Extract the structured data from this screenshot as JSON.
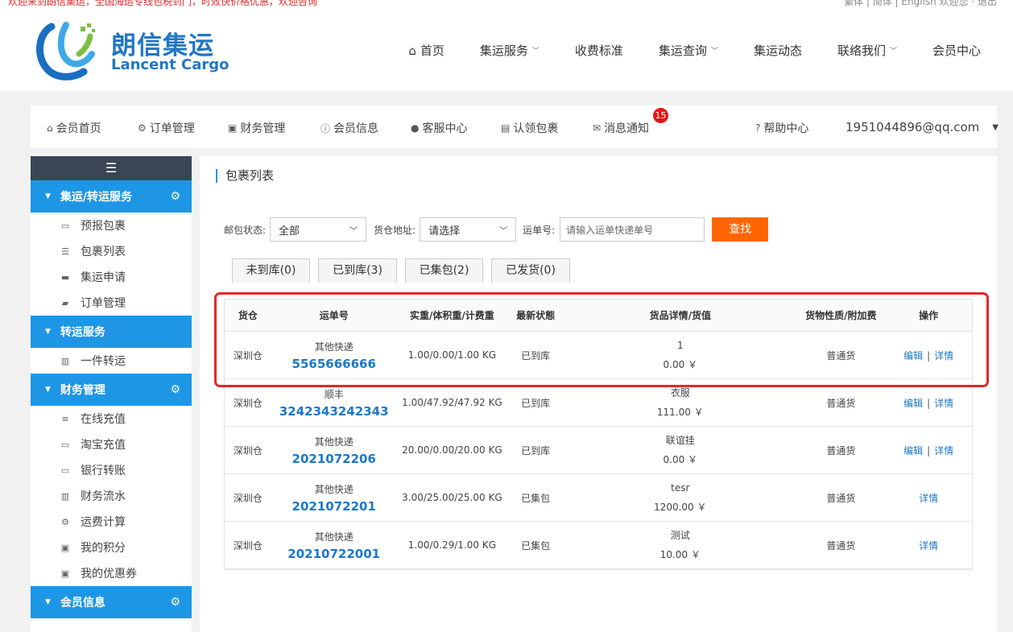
{
  "top_strip": {
    "left_text": "欢迎来到朗信集运，全国海运专线包税到门，时效快价格优惠，欢迎咨询",
    "right_text": "繁体 | 简体 | English 欢迎您 · 退出"
  },
  "logo": {
    "cn": "朗信集运",
    "en": "Lancent Cargo"
  },
  "main_nav": [
    {
      "label": "首页",
      "icon": "home-icon"
    },
    {
      "label": "集运服务",
      "dropdown": true
    },
    {
      "label": "收费标准"
    },
    {
      "label": "集运查询",
      "dropdown": true
    },
    {
      "label": "集运动态"
    },
    {
      "label": "联络我们",
      "dropdown": true
    },
    {
      "label": "会员中心"
    }
  ],
  "member_bar": {
    "items": [
      {
        "label": "会员首页",
        "icon": "home-icon"
      },
      {
        "label": "订单管理",
        "icon": "gear-icon"
      },
      {
        "label": "财务管理",
        "icon": "money-icon"
      },
      {
        "label": "会员信息",
        "icon": "info-icon"
      },
      {
        "label": "客服中心",
        "icon": "user-icon"
      },
      {
        "label": "认领包裹",
        "icon": "archive-icon"
      },
      {
        "label": "消息通知",
        "icon": "envelope-icon"
      }
    ],
    "badge_count": "15",
    "help_label": "帮助中心",
    "user_email": "1951044896@qq.com"
  },
  "sidebar": {
    "sections": [
      {
        "title": "集运/转运服务",
        "gear": true,
        "items": [
          {
            "label": "预报包裹",
            "icon": "inbox-icon"
          },
          {
            "label": "包裹列表",
            "icon": "list-icon"
          },
          {
            "label": "集运申请",
            "icon": "truck-icon"
          },
          {
            "label": "订单管理",
            "icon": "book-icon"
          }
        ]
      },
      {
        "title": "转运服务",
        "gear": false,
        "items": [
          {
            "label": "一件转运",
            "icon": "bar-chart-icon"
          }
        ]
      },
      {
        "title": "财务管理",
        "gear": true,
        "items": [
          {
            "label": "在线充值",
            "icon": "list-alt-icon"
          },
          {
            "label": "淘宝充值",
            "icon": "credit-card-icon"
          },
          {
            "label": "银行转账",
            "icon": "credit-card-icon"
          },
          {
            "label": "财务流水",
            "icon": "bar-chart-icon"
          },
          {
            "label": "运费计算",
            "icon": "cogs-icon"
          },
          {
            "label": "我的积分",
            "icon": "gift-icon"
          },
          {
            "label": "我的优惠券",
            "icon": "gift-icon"
          }
        ]
      },
      {
        "title": "会员信息",
        "gear": true,
        "items": []
      }
    ]
  },
  "content": {
    "title": "包裹列表",
    "filters": {
      "status_label": "邮包状态:",
      "status_value": "全部",
      "warehouse_label": "货仓地址:",
      "warehouse_value": "请选择",
      "tracking_label": "运单号:",
      "tracking_placeholder": "请输入运单快递单号",
      "search_button": "查找"
    },
    "tabs": [
      "未到库(0)",
      "已到库(3)",
      "已集包(2)",
      "已发货(0)"
    ],
    "table": {
      "headers": [
        "货仓",
        "运单号",
        "实重/体积重/计费重",
        "最新状態",
        "货品详情/货值",
        "货物性质/附加费",
        "操作"
      ],
      "rows": [
        {
          "warehouse": "深圳仓",
          "carrier": "其他快递",
          "tracking": "5565666666",
          "weights": "1.00/0.00/1.00 KG",
          "status": "已到库",
          "goods": "1",
          "value": "0.00 ￥",
          "nature": "普通货",
          "edit": "编辑",
          "detail": "详情",
          "editable": true
        },
        {
          "warehouse": "深圳仓",
          "carrier": "顺丰",
          "tracking": "3242343242343",
          "weights": "1.00/47.92/47.92 KG",
          "status": "已到库",
          "goods": "衣服",
          "value": "111.00 ￥",
          "nature": "普通货",
          "edit": "编辑",
          "detail": "详情",
          "editable": true
        },
        {
          "warehouse": "深圳仓",
          "carrier": "其他快递",
          "tracking": "2021072206",
          "weights": "20.00/0.00/20.00 KG",
          "status": "已到库",
          "goods": "联谊挂",
          "value": "0.00 ￥",
          "nature": "普通货",
          "edit": "编辑",
          "detail": "详情",
          "editable": true
        },
        {
          "warehouse": "深圳仓",
          "carrier": "其他快递",
          "tracking": "2021072201",
          "weights": "3.00/25.00/25.00 KG",
          "status": "已集包",
          "goods": "tesr",
          "value": "1200.00 ￥",
          "nature": "普通货",
          "edit": "",
          "detail": "详情",
          "editable": false
        },
        {
          "warehouse": "深圳仓",
          "carrier": "其他快递",
          "tracking": "20210722001",
          "weights": "1.00/0.29/1.00 KG",
          "status": "已集包",
          "goods": "测试",
          "value": "10.00 ￥",
          "nature": "普通货",
          "edit": "",
          "detail": "详情",
          "editable": false
        }
      ]
    }
  },
  "colors": {
    "primary": "#1e96e6",
    "dark": "#3a4656",
    "accent": "#ff6600",
    "highlight": "#e52828",
    "link": "#1a78c8"
  }
}
